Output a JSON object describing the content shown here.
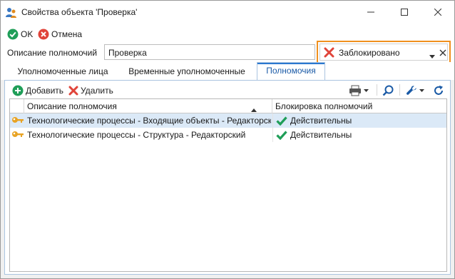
{
  "window": {
    "title": "Свойства объекта 'Проверка'"
  },
  "toolbar": {
    "ok_label": "OK",
    "cancel_label": "Отмена"
  },
  "description": {
    "label": "Описание полномочий",
    "value": "Проверка"
  },
  "status": {
    "value": "Заблокировано",
    "icon": "red-x-icon"
  },
  "tabs": [
    {
      "label": "Уполномоченные лица",
      "active": false
    },
    {
      "label": "Временные уполномоченные",
      "active": false
    },
    {
      "label": "Полномочия",
      "active": true
    }
  ],
  "grid_toolbar": {
    "add_label": "Добавить",
    "delete_label": "Удалить"
  },
  "grid": {
    "columns": [
      "Описание полномочия",
      "Блокировка полномочий"
    ],
    "rows": [
      {
        "description": "Технологические процессы - Входящие объекты - Редакторский",
        "status": "Действительны",
        "selected": true
      },
      {
        "description": "Технологические процессы - Структура - Редакторский",
        "status": "Действительны",
        "selected": false
      }
    ]
  },
  "colors": {
    "accent": "#2b78d0",
    "highlight_border": "#f0901e",
    "ok_green": "#1f9e58",
    "cancel_red": "#e0443a",
    "selected_row": "#dbe9f7"
  }
}
